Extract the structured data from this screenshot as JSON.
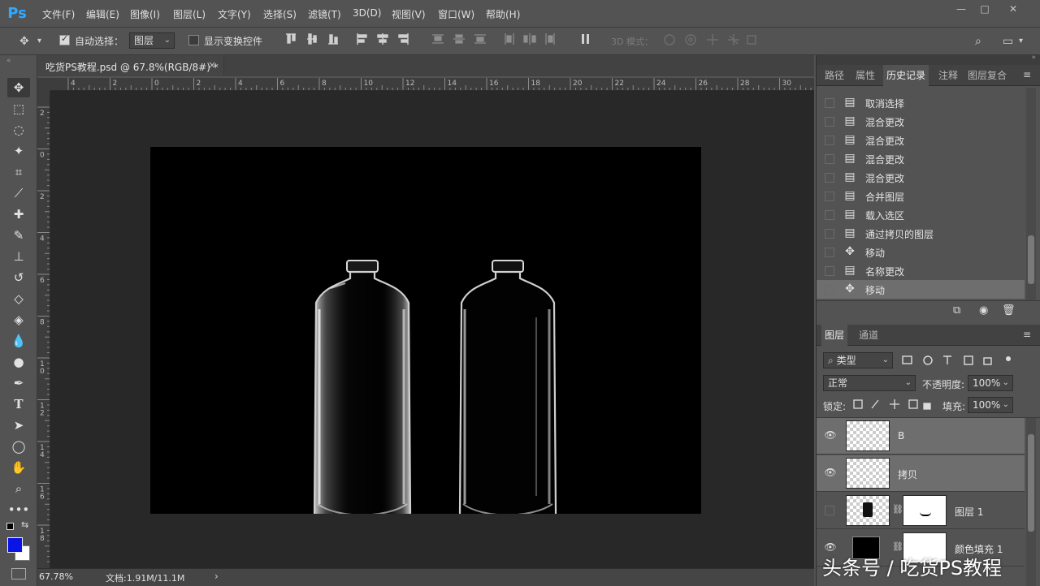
{
  "app": {
    "logo": "Ps"
  },
  "menu": [
    "文件(F)",
    "编辑(E)",
    "图像(I)",
    "图层(L)",
    "文字(Y)",
    "选择(S)",
    "滤镜(T)",
    "3D(D)",
    "视图(V)",
    "窗口(W)",
    "帮助(H)"
  ],
  "window_controls": {
    "minimize": "—",
    "maximize": "□",
    "close": "✕"
  },
  "options": {
    "auto_select_label": "自动选择：",
    "auto_select_checked": true,
    "auto_select_target": "图层",
    "show_transform_label": "显示变换控件",
    "mode_3d_label": "3D 模式："
  },
  "document": {
    "tab_title": "吃货PS教程.psd @ 67.8%(RGB/8#) *",
    "close_glyph": "×"
  },
  "ruler": {
    "top_labels": [
      "4",
      "2",
      "0",
      "2",
      "4",
      "6",
      "8",
      "10",
      "12",
      "14",
      "16",
      "18",
      "20",
      "22",
      "24",
      "26",
      "28",
      "30"
    ],
    "left_labels": [
      "2",
      "0",
      "2",
      "4",
      "6",
      "8",
      "1 0",
      "1 2",
      "1 4",
      "1 6",
      "1 8"
    ]
  },
  "status": {
    "zoom": "67.78%",
    "doc_info": "文档:1.91M/11.1M",
    "arrow": "›"
  },
  "history_panel": {
    "tabs": [
      "路径",
      "属性",
      "历史记录",
      "注释",
      "图层复合"
    ],
    "active_tab": "历史记录",
    "items": [
      {
        "label": "取消选择",
        "icon": "document-icon"
      },
      {
        "label": "混合更改",
        "icon": "document-icon"
      },
      {
        "label": "混合更改",
        "icon": "document-icon"
      },
      {
        "label": "混合更改",
        "icon": "document-icon"
      },
      {
        "label": "混合更改",
        "icon": "document-icon"
      },
      {
        "label": "合并图层",
        "icon": "document-icon"
      },
      {
        "label": "载入选区",
        "icon": "document-icon"
      },
      {
        "label": "通过拷贝的图层",
        "icon": "document-icon"
      },
      {
        "label": "移动",
        "icon": "move-icon"
      },
      {
        "label": "名称更改",
        "icon": "document-icon"
      },
      {
        "label": "移动",
        "icon": "move-icon"
      }
    ]
  },
  "layers_panel": {
    "tabs": [
      "图层",
      "通道"
    ],
    "active_tab": "图层",
    "filter_label": "类型",
    "blend_mode": "正常",
    "opacity_label": "不透明度:",
    "opacity_value": "100%",
    "lock_label": "锁定:",
    "fill_label": "填充:",
    "fill_value": "100%",
    "layers": [
      {
        "name": "B",
        "visible": true
      },
      {
        "name": "拷贝",
        "visible": true
      },
      {
        "name": "图层 1",
        "visible": false
      },
      {
        "name": "颜色填充 1",
        "visible": true
      }
    ]
  },
  "colors": {
    "foreground": "#0a14e6",
    "background": "#ffffff",
    "accent": "#31a8ff"
  },
  "watermark": "头条号 / 吃货PS教程"
}
